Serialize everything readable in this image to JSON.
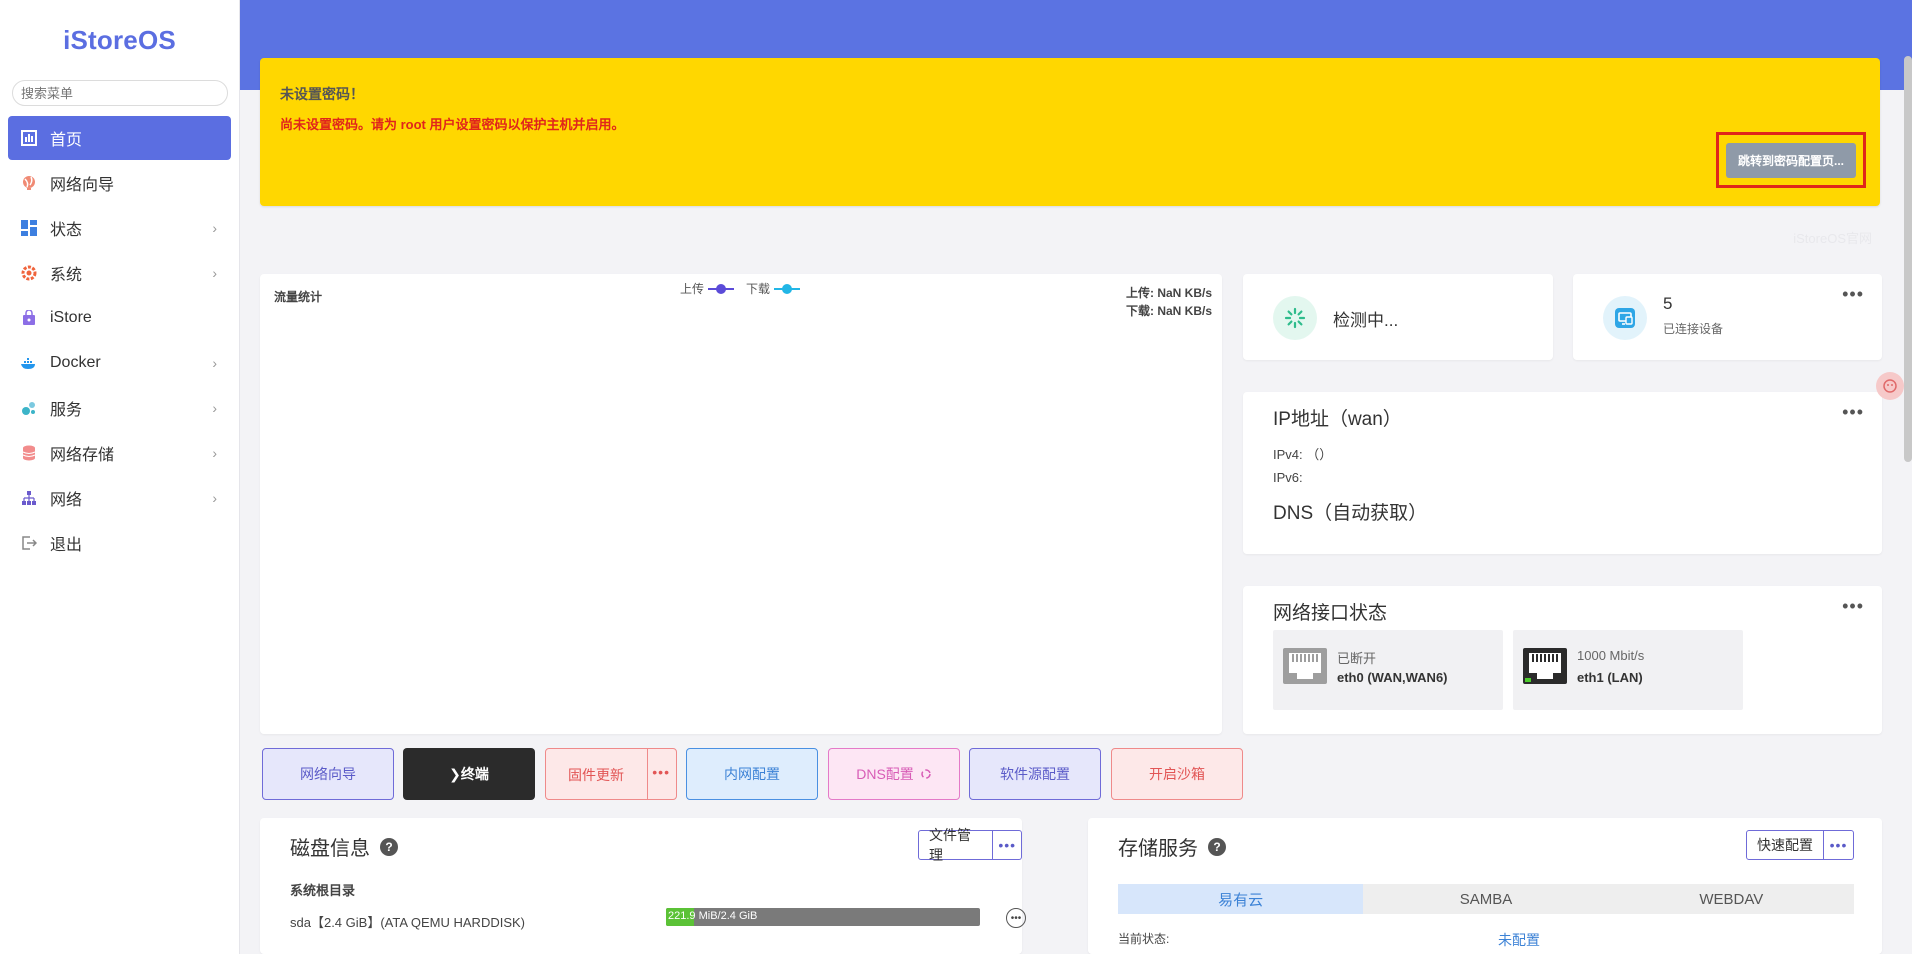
{
  "brand": "iStoreOS",
  "search": {
    "placeholder": "搜索菜单"
  },
  "sidebar": {
    "items": [
      {
        "label": "首页",
        "icon": "dashboard-icon",
        "active": true,
        "has_children": false
      },
      {
        "label": "网络向导",
        "icon": "globe-icon",
        "active": false,
        "has_children": false
      },
      {
        "label": "状态",
        "icon": "grid-icon",
        "active": false,
        "has_children": true
      },
      {
        "label": "系统",
        "icon": "gear-icon",
        "active": false,
        "has_children": true
      },
      {
        "label": "iStore",
        "icon": "bag-icon",
        "active": false,
        "has_children": false
      },
      {
        "label": "Docker",
        "icon": "whale-icon",
        "active": false,
        "has_children": true
      },
      {
        "label": "服务",
        "icon": "puzzle-icon",
        "active": false,
        "has_children": true
      },
      {
        "label": "网络存储",
        "icon": "database-icon",
        "active": false,
        "has_children": true
      },
      {
        "label": "网络",
        "icon": "network-icon",
        "active": false,
        "has_children": true
      },
      {
        "label": "退出",
        "icon": "logout-icon",
        "active": false,
        "has_children": false
      }
    ]
  },
  "alert": {
    "title": "未设置密码！",
    "message": "尚未设置密码。请为 root 用户设置密码以保护主机并启用。",
    "button": "跳转到密码配置页..."
  },
  "site_link": "iStoreOS官网",
  "traffic": {
    "title": "流量统计",
    "legend_up": "上传",
    "legend_down": "下载",
    "up_rate": "上传: NaN KB/s",
    "down_rate": "下载: NaN KB/s"
  },
  "status": {
    "detecting": "检测中...",
    "device_count": "5",
    "device_label": "已连接设备"
  },
  "ip": {
    "title": "IP地址（wan）",
    "ipv4": "IPv4: （）",
    "ipv6": "IPv6:",
    "dns": "DNS（自动获取）"
  },
  "net_if": {
    "title": "网络接口状态",
    "ports": [
      {
        "status": "已断开",
        "name": "eth0 (WAN,WAN6)"
      },
      {
        "status": "1000 Mbit/s",
        "name": "eth1 (LAN)"
      }
    ]
  },
  "actions": {
    "wizard": "网络向导",
    "terminal": "❯终端",
    "firmware": "固件更新",
    "more": "•••",
    "lan": "内网配置",
    "dns": "DNS配置",
    "repo": "软件源配置",
    "sandbox": "开启沙箱"
  },
  "disk": {
    "title": "磁盘信息",
    "file_mgr": "文件管理",
    "more": "•••",
    "section": "系统根目录",
    "row": "sda【2.4 GiB】(ATA QEMU HARDDISK)",
    "usage_used": "221.9",
    "usage_text": "MiB/2.4 GiB",
    "usage_fraction": 0.09
  },
  "storage": {
    "title": "存储服务",
    "quick": "快速配置",
    "more": "•••",
    "tabs": [
      "易有云",
      "SAMBA",
      "WEBDAV"
    ],
    "status_key": "当前状态:",
    "status_val": "未配置"
  },
  "colors": {
    "accent": "#5b6ee1",
    "header": "#5b73e2",
    "warning": "#ffd700",
    "danger": "#e0251b",
    "upload": "#5b4bd8",
    "download": "#22b6e6"
  }
}
